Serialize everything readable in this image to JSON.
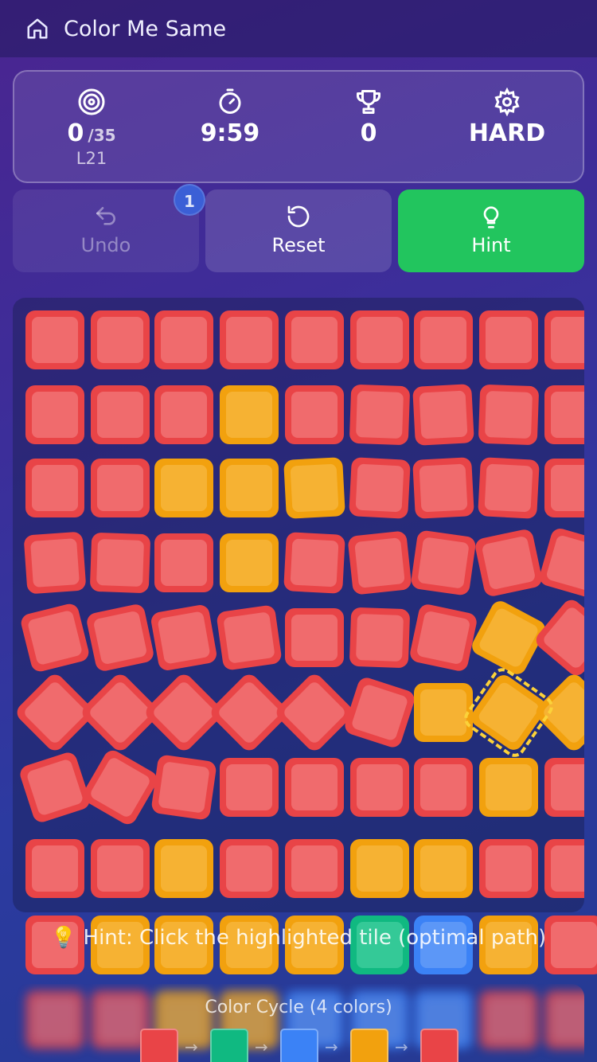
{
  "app": {
    "title": "Color Me Same"
  },
  "stats": {
    "moves": "0",
    "moves_max": "/35",
    "level": "L21",
    "timer": "9:59",
    "score": "0",
    "difficulty": "HARD"
  },
  "actions": {
    "undo_label": "Undo",
    "undo_badge": "1",
    "reset_label": "Reset",
    "hint_label": "Hint"
  },
  "board": {
    "grid": [
      [
        "red",
        "red",
        "red",
        "red",
        "red",
        "red",
        "red",
        "red",
        "red"
      ],
      [
        "red",
        "red",
        "red",
        "orange",
        "red",
        "red",
        "red",
        "red",
        "red"
      ],
      [
        "red",
        "red",
        "orange",
        "orange",
        "orange",
        "red",
        "red",
        "red",
        "red"
      ],
      [
        "red",
        "red",
        "red",
        "orange",
        "red",
        "red",
        "red",
        "red",
        "red"
      ],
      [
        "red",
        "red",
        "red",
        "red",
        "red",
        "red",
        "red",
        "orange",
        "red"
      ],
      [
        "red",
        "red",
        "red",
        "red",
        "red",
        "red",
        "orange",
        "orange",
        "orange"
      ],
      [
        "red",
        "red",
        "red",
        "red",
        "red",
        "red",
        "red",
        "orange",
        "red"
      ],
      [
        "red",
        "red",
        "orange",
        "red",
        "red",
        "orange",
        "orange",
        "red",
        "red"
      ]
    ],
    "last_row": [
      "red",
      "orange",
      "orange",
      "orange",
      "orange",
      "green",
      "blue",
      "orange",
      "red"
    ],
    "highlighted_tile": {
      "row": 5,
      "col": 7
    }
  },
  "hint_text": "💡 Hint: Click the highlighted tile (optimal path)",
  "color_cycle": {
    "title": "Color Cycle (4 colors)",
    "colors": [
      "red",
      "green",
      "blue",
      "orange",
      "red"
    ],
    "arrow": "→"
  },
  "colors": {
    "red": "#e94447",
    "orange": "#f2a10e",
    "green": "#10b981",
    "blue": "#3b82f6",
    "hint_button": "#22c55e",
    "hint_outline": "#fbd23a"
  }
}
